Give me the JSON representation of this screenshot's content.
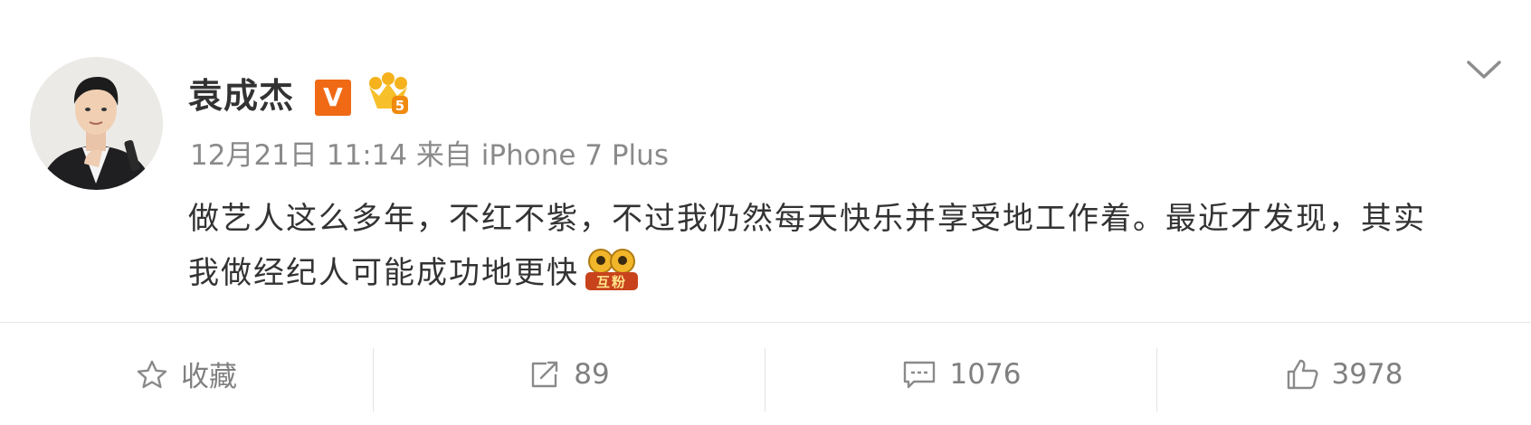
{
  "post": {
    "author": "袁成杰",
    "verified_badge": "V",
    "meta": "12月21日 11:14 来自 iPhone 7 Plus",
    "content": "做艺人这么多年，不红不紫，不过我仍然每天快乐并享受地工作着。最近才发现，其实我做经纪人可能成功地更快",
    "emoji_label": "互粉",
    "icons": {
      "avatar": "avatar",
      "crown": "crown-icon",
      "menu": "chevron-down-icon"
    }
  },
  "toolbar": {
    "favorite": {
      "label": "收藏",
      "icon": "star-icon"
    },
    "repost": {
      "count": "89",
      "icon": "repost-icon"
    },
    "comment": {
      "count": "1076",
      "icon": "comment-icon"
    },
    "like": {
      "count": "3978",
      "icon": "thumbs-up-icon"
    }
  },
  "colors": {
    "accent_orange": "#f06914",
    "text_primary": "#333333",
    "text_secondary": "#808080"
  }
}
